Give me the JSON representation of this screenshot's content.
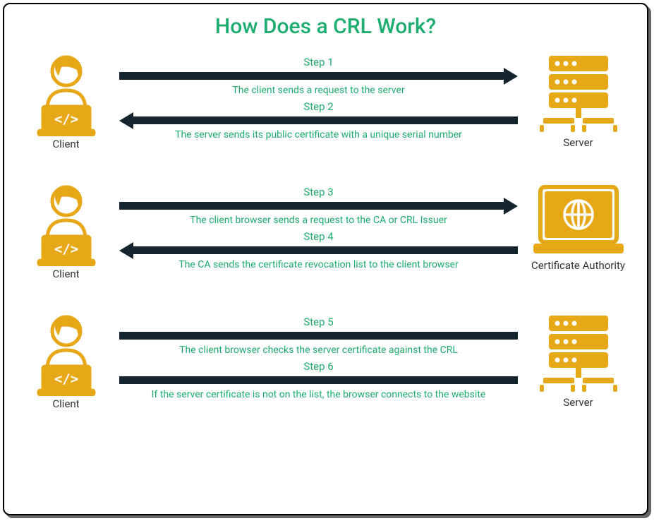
{
  "title": "How Does a CRL Work?",
  "sections": [
    {
      "left_label": "Client",
      "right_label": "Server",
      "right_icon": "server",
      "steps": [
        {
          "label": "Step 1",
          "desc": "The client sends a request to the server",
          "arrow": "right"
        },
        {
          "label": "Step 2",
          "desc": "The server sends its public certificate with a unique serial number",
          "arrow": "left"
        }
      ]
    },
    {
      "left_label": "Client",
      "right_label": "Certificate Authority",
      "right_icon": "ca",
      "steps": [
        {
          "label": "Step 3",
          "desc": "The client browser sends a request to the CA or CRL Issuer",
          "arrow": "right"
        },
        {
          "label": "Step 4",
          "desc": "The CA sends the certificate revocation list to the client browser",
          "arrow": "left"
        }
      ]
    },
    {
      "left_label": "Client",
      "right_label": "Server",
      "right_icon": "server",
      "steps": [
        {
          "label": "Step 5",
          "desc": "The client browser checks the server certificate against the CRL",
          "arrow": "none"
        },
        {
          "label": "Step 6",
          "desc": "If the server certificate is not on the list, the browser connects to the website",
          "arrow": "none"
        }
      ]
    }
  ]
}
